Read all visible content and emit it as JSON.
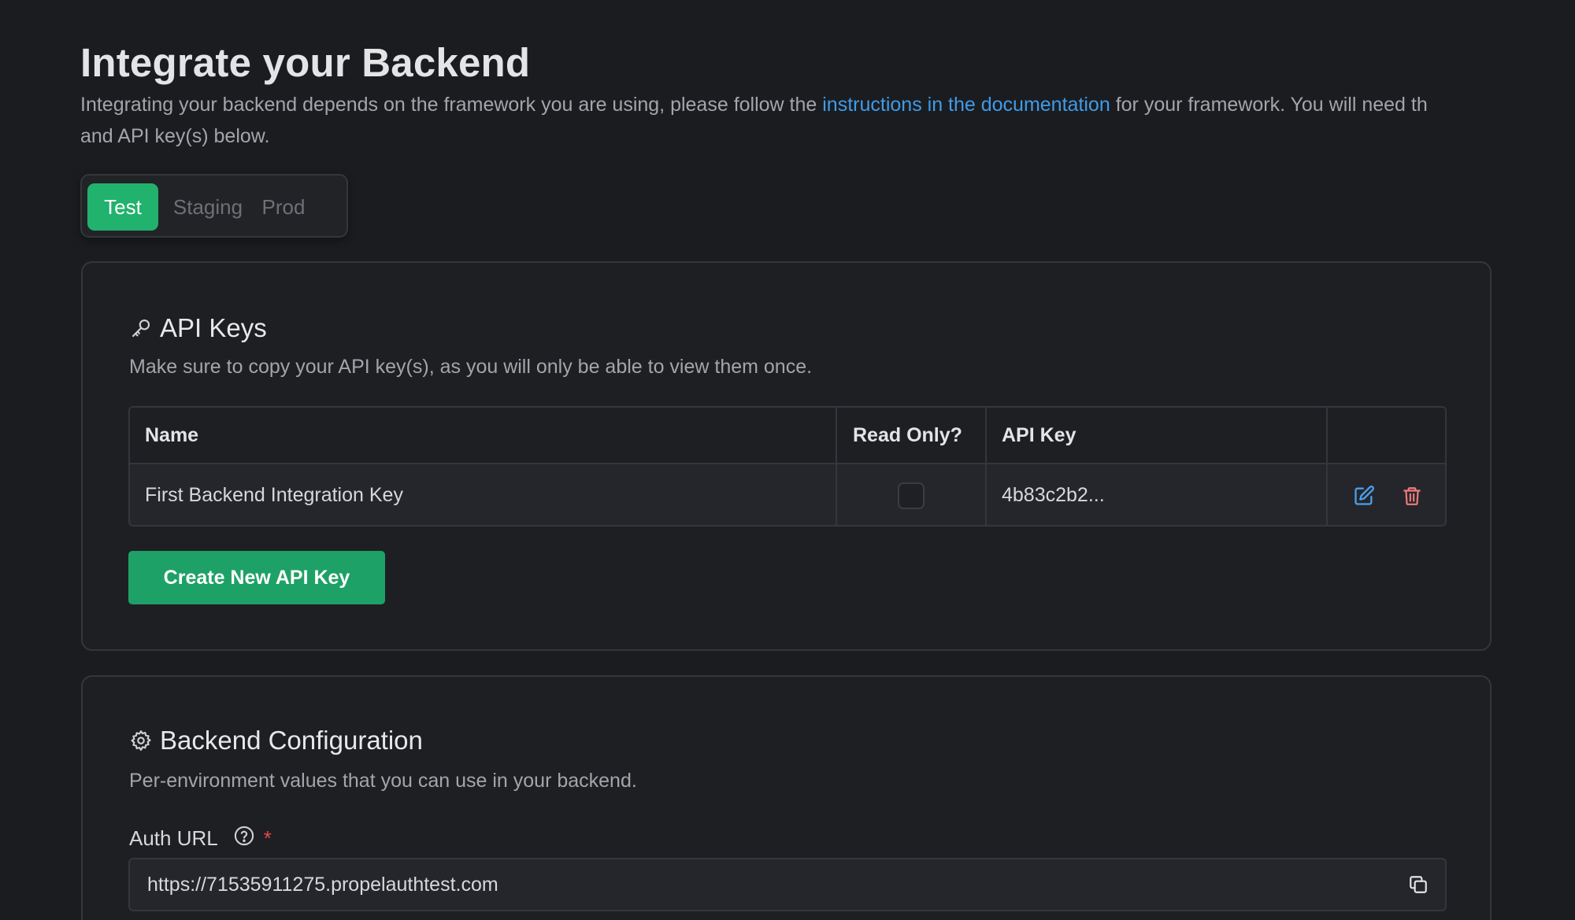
{
  "header": {
    "title": "Integrate your Backend",
    "intro_before": "Integrating your backend depends on the framework you are using, please follow the ",
    "intro_link": "instructions in the documentation",
    "intro_after": " for your framework. You will need th",
    "intro_line2": "and API key(s) below."
  },
  "env_tabs": [
    {
      "label": "Test",
      "active": true
    },
    {
      "label": "Staging",
      "active": false
    },
    {
      "label": "Prod",
      "active": false
    }
  ],
  "api_keys": {
    "icon": "key-icon",
    "title": "API Keys",
    "description": "Make sure to copy your API key(s), as you will only be able to view them once.",
    "columns": [
      "Name",
      "Read Only?",
      "API Key",
      ""
    ],
    "rows": [
      {
        "name": "First Backend Integration Key",
        "read_only": false,
        "api_key": "4b83c2b2..."
      }
    ],
    "create_label": "Create New API Key"
  },
  "backend_config": {
    "icon": "gear-icon",
    "title": "Backend Configuration",
    "description": "Per-environment values that you can use in your backend.",
    "auth_url": {
      "label": "Auth URL",
      "required_mark": "*",
      "value": "https://71535911275.propelauthtest.com"
    }
  },
  "colors": {
    "accent_green": "#21b26d",
    "button_green": "#1ea166",
    "link_blue": "#3f9be8",
    "edit_icon_blue": "#4a9fea",
    "delete_icon_red": "#f07b7b",
    "required_red": "#e5484d",
    "background": "#1b1c20"
  }
}
